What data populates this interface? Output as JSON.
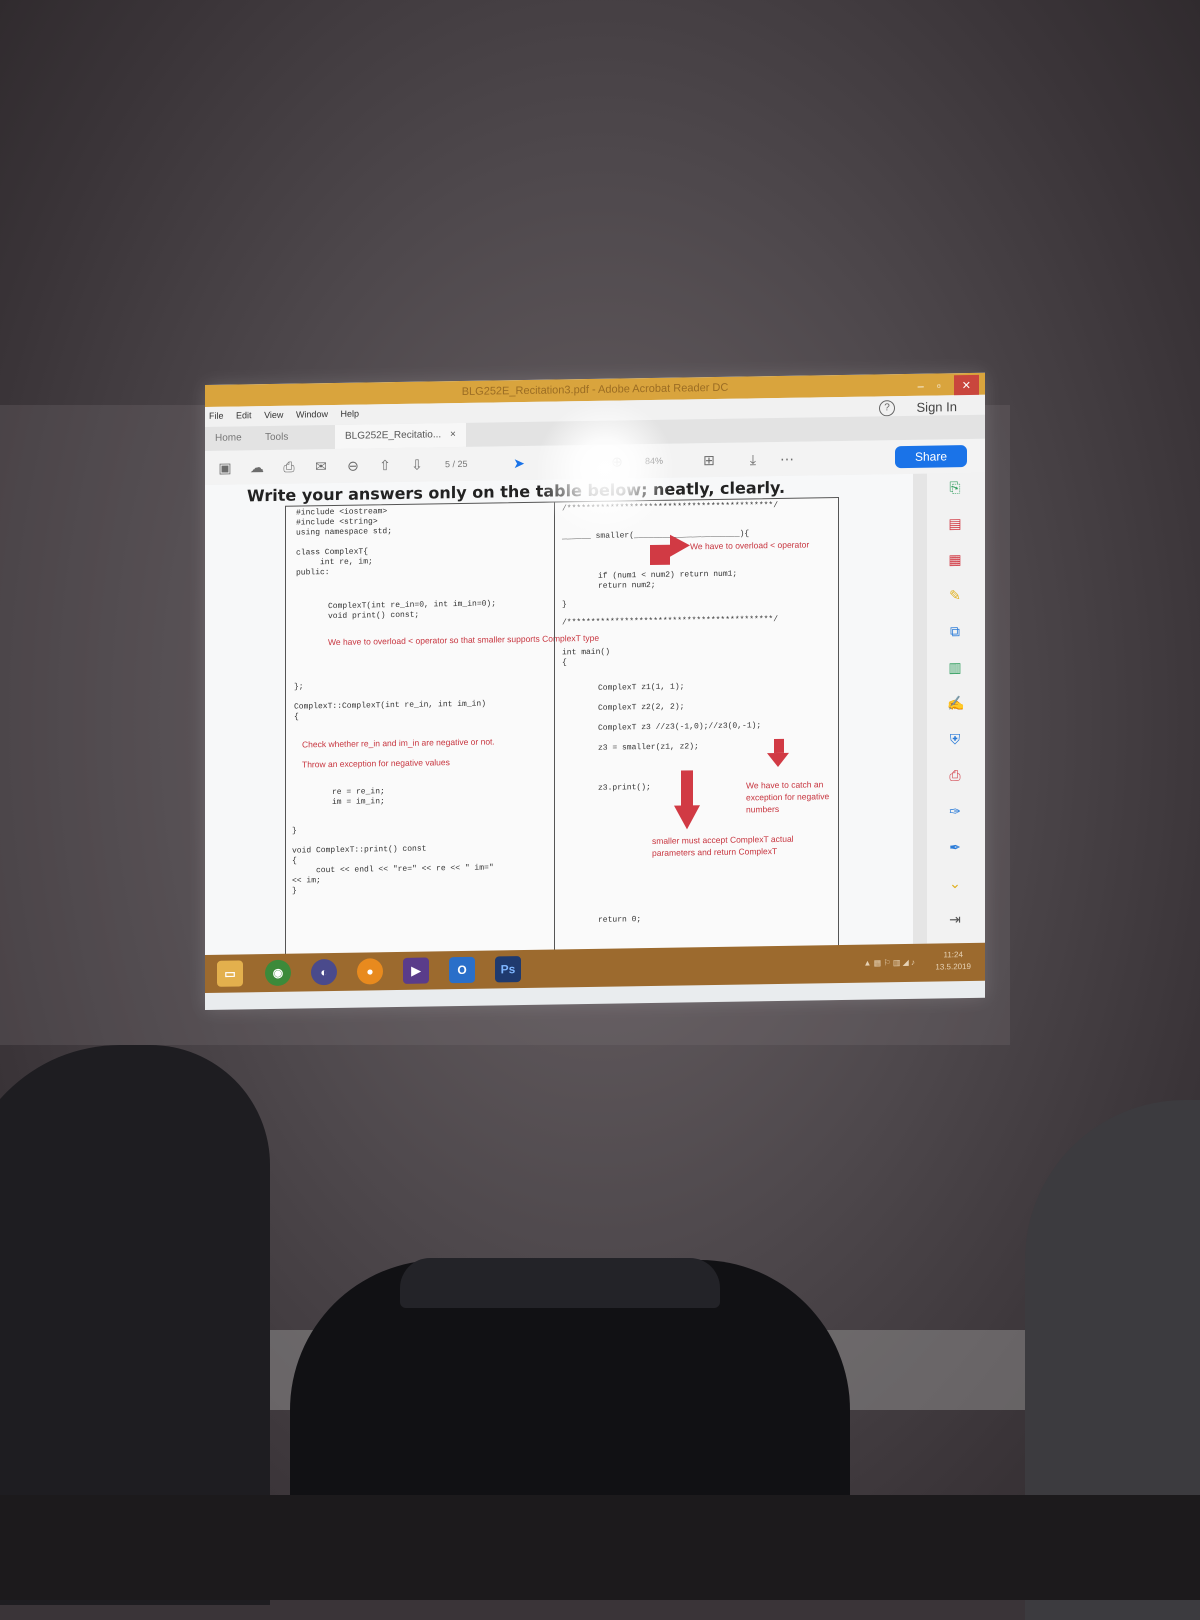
{
  "window": {
    "title": "BLG252E_Recitation3.pdf - Adobe Acrobat Reader DC",
    "menu": [
      "File",
      "Edit",
      "View",
      "Window",
      "Help"
    ],
    "sign_in": "Sign In"
  },
  "tabs": {
    "home": "Home",
    "tools": "Tools",
    "document": "BLG252E_Recitatio...",
    "close": "×"
  },
  "toolbar": {
    "page_current": "5",
    "page_total": "/ 25",
    "zoom": "84%",
    "share": "Share"
  },
  "document": {
    "heading": "Write your answers only on the table below; neatly, clearly.",
    "left_code_1": "#include <iostream>\n#include <string>\nusing namespace std;\n\nclass ComplexT{\n     int re, im;\npublic:",
    "left_code_2": "ComplexT(int re_in=0, int im_in=0);\nvoid print() const;",
    "note_overload": "We have to overload < operator so that\nsmaller supports ComplexT type",
    "left_code_3": "};\n\nComplexT::ComplexT(int re_in, int im_in)\n{",
    "note_check": "Check whether re_in and im_in are negative or not.",
    "note_throw": "Throw an exception for negative values",
    "left_code_4": "re = re_in;\nim = im_in;",
    "left_code_5": "}\n\nvoid ComplexT::print() const\n{\n     cout << endl << \"re=\" << re << \" im=\"\n<< im;\n}",
    "right_code_stars_top": "/*******************************************/",
    "right_code_smaller": "______ smaller(______________________){",
    "note_overload_op": "We have to overload < operator",
    "right_code_if": "if (num1 < num2) return num1;\nreturn num2;",
    "right_code_close": "}",
    "right_code_stars_mid": "/*******************************************/",
    "right_code_main": "int main()\n{",
    "right_code_body": "ComplexT z1(1, 1);\n\nComplexT z2(2, 2);\n\nComplexT z3 //z3(-1,0);//z3(0,-1);\n\nz3 = smaller(z1, z2);\n\n\n\nz3.print();",
    "note_catch": "We have to catch\nan exception for\nnegative numbers",
    "note_smaller": "smaller must accept\nComplexT actual\nparameters and\nreturn ComplexT",
    "right_code_return": "return 0;"
  },
  "taskbar": {
    "time": "11:24",
    "date": "13.5.2019",
    "apps": [
      "file-explorer-icon",
      "chrome-icon",
      "eclipse-icon",
      "media-icon",
      "visual-studio-icon",
      "outlook-icon",
      "photoshop-icon"
    ],
    "outlook_label": "O",
    "ps_label": "Ps"
  },
  "colors": {
    "annotation_red": "#d13a44",
    "titlebar": "#d9a43d",
    "share_blue": "#1a73e8"
  }
}
